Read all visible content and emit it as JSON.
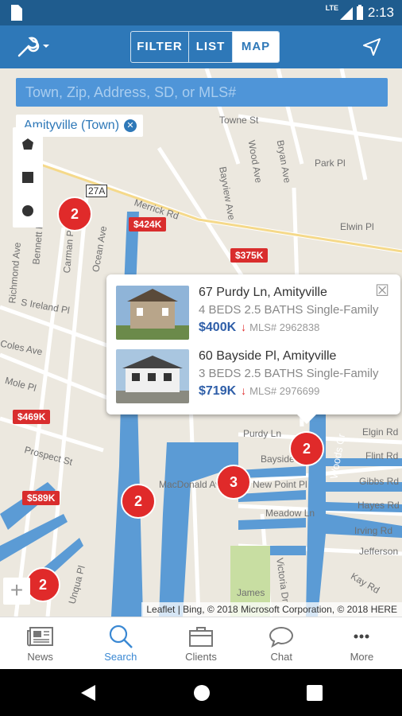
{
  "status": {
    "time": "2:13",
    "network": "LTE"
  },
  "appbar": {
    "tabs": [
      "FILTER",
      "LIST",
      "MAP"
    ],
    "active_tab": "MAP"
  },
  "search": {
    "placeholder": "Town, Zip, Address, SD, or MLS#"
  },
  "filter_chip": {
    "label": "Amityville (Town)"
  },
  "clusters": [
    "2",
    "2",
    "2",
    "3",
    "2"
  ],
  "prices": [
    "$424K",
    "$375K",
    "$469K",
    "$589K"
  ],
  "roads": [
    "Towne St",
    "Park Pl",
    "Elwin Pl",
    "Merrick Rd",
    "27A",
    "Ocean Ave",
    "Bayview Ave",
    "Bryan Ave",
    "Wood Ave",
    "S Ireland Pl",
    "Coles Ave",
    "Mole Pl",
    "Prospect St",
    "MacDonald Ave",
    "New Point Pl",
    "Meadow Ln",
    "Purdy Ln",
    "Elgin Rd",
    "Flint Rd",
    "Gibbs Rd",
    "Hayes Rd",
    "Irving Rd",
    "Jefferson",
    "Kay Rd",
    "Bayside",
    "Carman Pl",
    "Bennett Pl",
    "Richmond Ave",
    "Woods Cr",
    "Unqua Pl",
    "James",
    "Victoria Dr"
  ],
  "popup": {
    "listings": [
      {
        "address": "67 Purdy Ln, Amityville",
        "details": "4 BEDS 2.5 BATHS Single-Family",
        "price": "$400K",
        "mls": "MLS# 2962838"
      },
      {
        "address": "60 Bayside Pl, Amityville",
        "details": "3 BEDS 2.5 BATHS Single-Family",
        "price": "$719K",
        "mls": "MLS# 2976699"
      }
    ]
  },
  "attribution": "Leaflet | Bing, © 2018 Microsoft Corporation, © 2018 HERE",
  "bottom_nav": [
    {
      "label": "News",
      "icon": "news-icon"
    },
    {
      "label": "Search",
      "icon": "search-icon"
    },
    {
      "label": "Clients",
      "icon": "briefcase-icon"
    },
    {
      "label": "Chat",
      "icon": "chat-icon"
    },
    {
      "label": "More",
      "icon": "more-icon"
    }
  ],
  "colors": {
    "primary": "#2e78b8",
    "status": "#1f5c8e",
    "accent": "#e02a2a",
    "water": "#5b9bd5"
  }
}
